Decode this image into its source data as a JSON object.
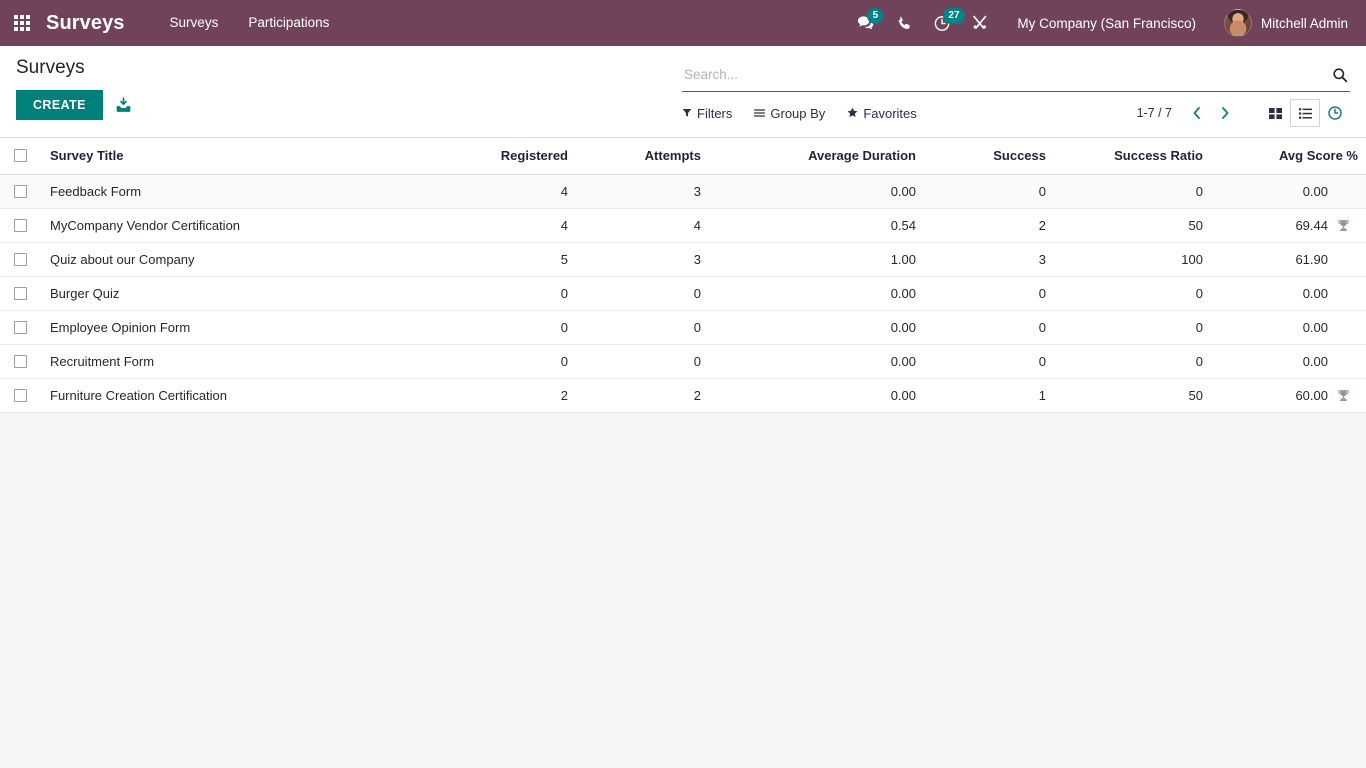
{
  "navbar": {
    "apps_icon": "apps-grid-icon",
    "brand": "Surveys",
    "menu": [
      {
        "label": "Surveys"
      },
      {
        "label": "Participations"
      }
    ],
    "icons": [
      {
        "name": "messaging-icon",
        "badge": "5"
      },
      {
        "name": "phone-icon",
        "badge": ""
      },
      {
        "name": "activity-clock-icon",
        "badge": "27"
      },
      {
        "name": "debug-tools-icon",
        "badge": ""
      }
    ],
    "company": "My Company (San Francisco)",
    "user": "Mitchell Admin",
    "colors": {
      "navbar_bg": "#71435B",
      "badge_bg": "#00848B",
      "accent_teal": "#00807B"
    }
  },
  "control_panel": {
    "title": "Surveys",
    "create_label": "CREATE",
    "import_icon": "import-upload-icon",
    "search": {
      "placeholder": "Search...",
      "value": "",
      "icon": "search-icon"
    },
    "facets": [
      {
        "name": "filters",
        "icon": "filter-funnel-icon",
        "label": "Filters"
      },
      {
        "name": "group-by",
        "icon": "bars-icon",
        "label": "Group By"
      },
      {
        "name": "favorites",
        "icon": "star-icon",
        "label": "Favorites"
      }
    ],
    "pager": {
      "count": "1-7 / 7",
      "prev_icon": "chevron-left-icon",
      "next_icon": "chevron-right-icon"
    },
    "views": [
      {
        "name": "kanban-view",
        "icon": "kanban-grid-icon",
        "active": false
      },
      {
        "name": "list-view",
        "icon": "list-icon",
        "active": true
      },
      {
        "name": "activity-view",
        "icon": "clock-icon",
        "active": false
      }
    ]
  },
  "table": {
    "columns": [
      {
        "key": "title",
        "label": "Survey Title",
        "align": "left"
      },
      {
        "key": "registered",
        "label": "Registered",
        "align": "right"
      },
      {
        "key": "attempts",
        "label": "Attempts",
        "align": "right"
      },
      {
        "key": "average_duration",
        "label": "Average Duration",
        "align": "right"
      },
      {
        "key": "success",
        "label": "Success",
        "align": "right"
      },
      {
        "key": "success_ratio",
        "label": "Success Ratio",
        "align": "right"
      },
      {
        "key": "avg_score",
        "label": "Avg Score %",
        "align": "right"
      }
    ],
    "optional_columns_icon": "kebab-menu-icon",
    "rows": [
      {
        "title": "Feedback Form",
        "registered": "4",
        "attempts": "3",
        "average_duration": "0.00",
        "success": "0",
        "success_ratio": "0",
        "avg_score": "0.00",
        "certification": false,
        "highlight": true
      },
      {
        "title": "MyCompany Vendor Certification",
        "registered": "4",
        "attempts": "4",
        "average_duration": "0.54",
        "success": "2",
        "success_ratio": "50",
        "avg_score": "69.44",
        "certification": true,
        "highlight": false
      },
      {
        "title": "Quiz about our Company",
        "registered": "5",
        "attempts": "3",
        "average_duration": "1.00",
        "success": "3",
        "success_ratio": "100",
        "avg_score": "61.90",
        "certification": false,
        "highlight": false
      },
      {
        "title": "Burger Quiz",
        "registered": "0",
        "attempts": "0",
        "average_duration": "0.00",
        "success": "0",
        "success_ratio": "0",
        "avg_score": "0.00",
        "certification": false,
        "highlight": false
      },
      {
        "title": "Employee Opinion Form",
        "registered": "0",
        "attempts": "0",
        "average_duration": "0.00",
        "success": "0",
        "success_ratio": "0",
        "avg_score": "0.00",
        "certification": false,
        "highlight": false
      },
      {
        "title": "Recruitment Form",
        "registered": "0",
        "attempts": "0",
        "average_duration": "0.00",
        "success": "0",
        "success_ratio": "0",
        "avg_score": "0.00",
        "certification": false,
        "highlight": false
      },
      {
        "title": "Furniture Creation Certification",
        "registered": "2",
        "attempts": "2",
        "average_duration": "0.00",
        "success": "1",
        "success_ratio": "50",
        "avg_score": "60.00",
        "certification": true,
        "highlight": false
      }
    ]
  }
}
